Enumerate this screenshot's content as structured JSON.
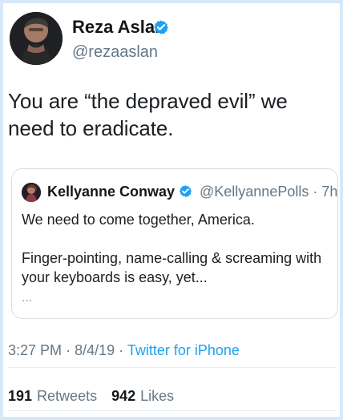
{
  "tweet": {
    "author": {
      "name": "Reza Aslan",
      "handle": "@rezaaslan"
    },
    "text": "You are “the depraved evil” we need to eradicate.",
    "quote": {
      "author_name": "Kellyanne Conway",
      "handle": "@KellyannePolls",
      "separator": "·",
      "age": "7h",
      "text_line_1": "We need to come together, America.",
      "text_line_2": "Finger-pointing, name-calling & screaming with your keyboards is easy, yet...",
      "ellipsis": "..."
    },
    "timestamp": {
      "time": "3:27 PM",
      "separator_1": "·",
      "date": "8/4/19",
      "separator_2": "·",
      "client": "Twitter for iPhone"
    },
    "stats": {
      "retweets_count": "191",
      "retweets_label": "Retweets",
      "likes_count": "942",
      "likes_label": "Likes"
    }
  },
  "colors": {
    "accent": "#1da1f2",
    "border": "#d7e9f8",
    "muted_text": "#657786"
  },
  "icons": {
    "main_verified": "verified-badge-icon",
    "quote_verified": "verified-badge-icon"
  }
}
